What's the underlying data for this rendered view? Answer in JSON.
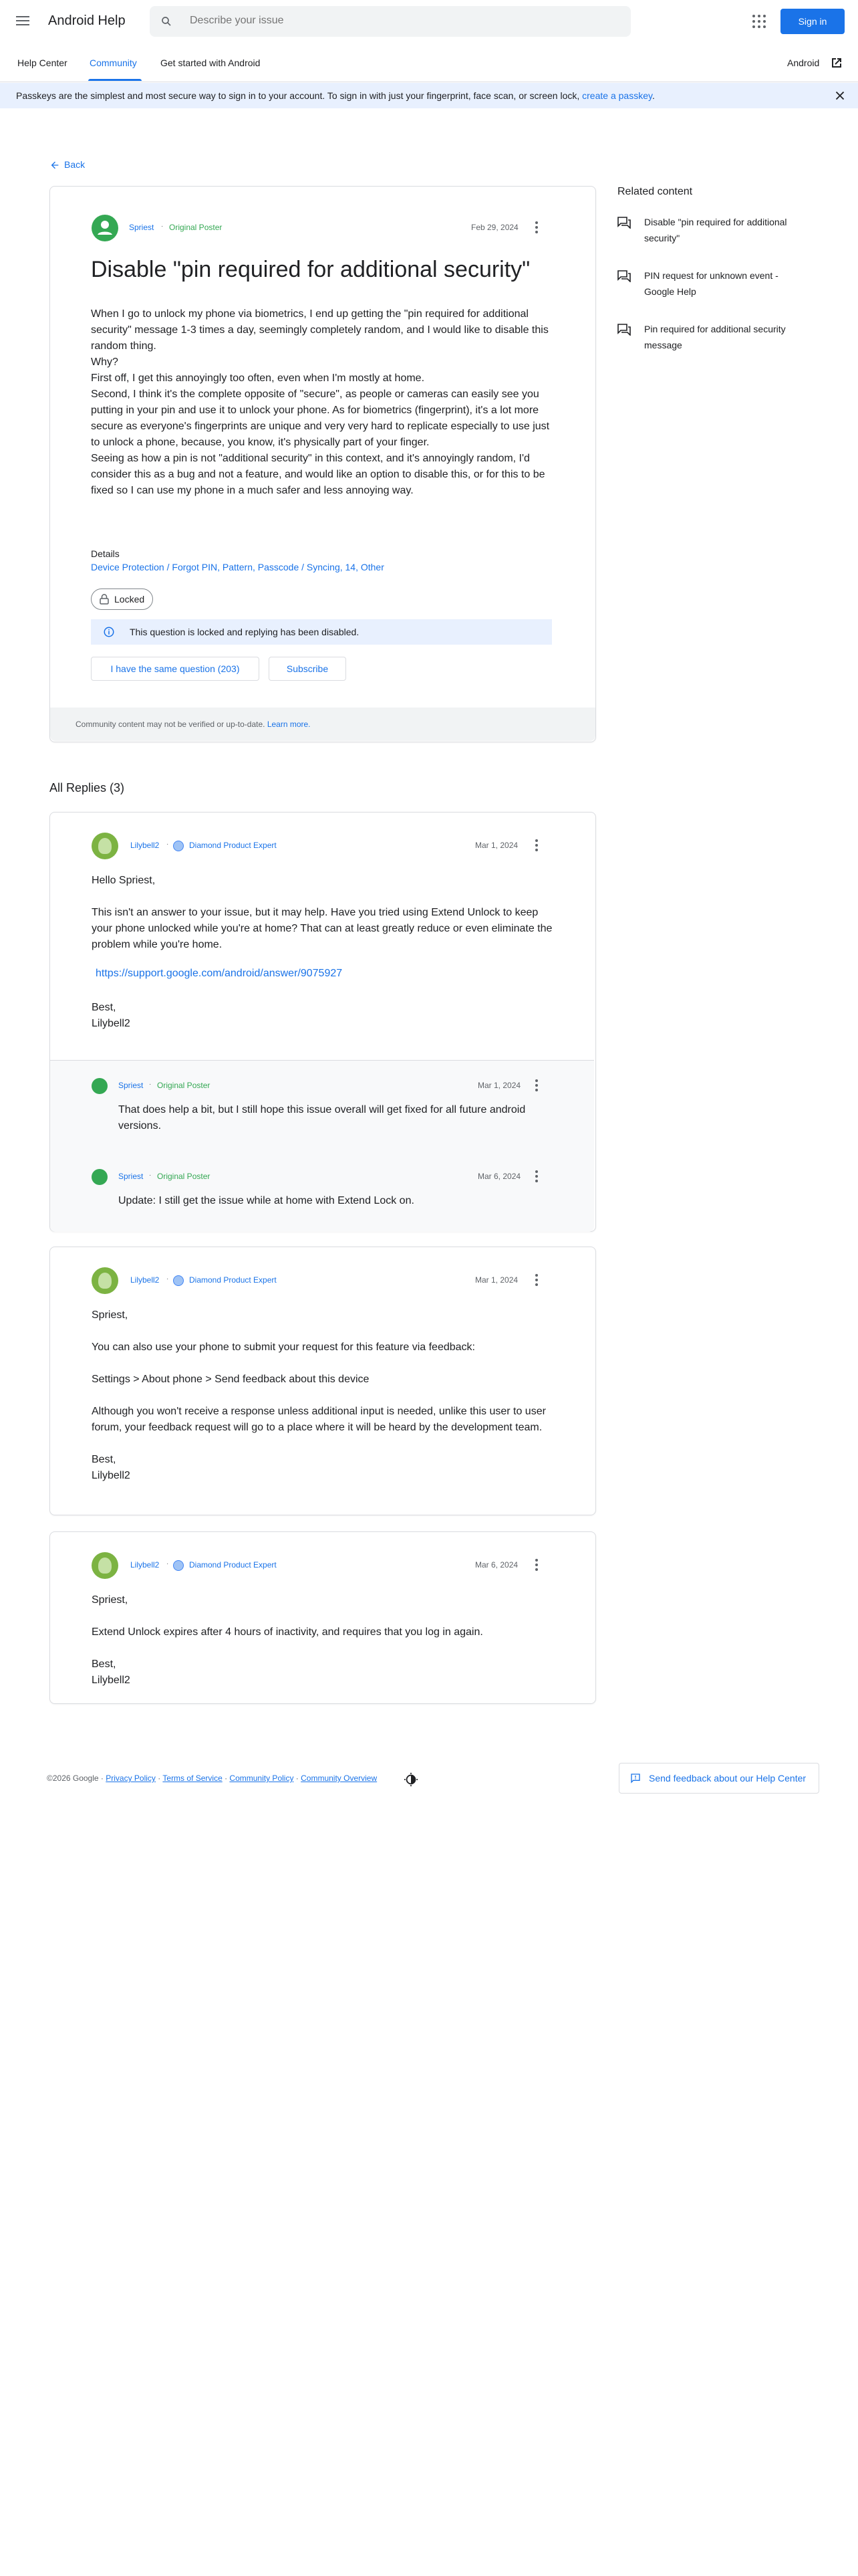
{
  "header": {
    "brand": "Android Help",
    "search_placeholder": "Describe your issue",
    "signin_label": "Sign in"
  },
  "tabs": [
    "Help Center",
    "Community",
    "Get started with Android"
  ],
  "android_link": "Android",
  "banner": {
    "text": "Passkeys are the simplest and most secure way to sign in to your account. To sign in with just your fingerprint, face scan, or screen lock, ",
    "link": "create a passkey",
    "suffix": "."
  },
  "back_label": "Back",
  "question": {
    "author": "Spriest",
    "author_badge": "Original Poster",
    "date": "Feb 29, 2024",
    "title": "Disable \"pin required for additional security\"",
    "body": "When I go to unlock my phone via biometrics, I end up getting the \"pin required for additional security\" message 1-3 times a day, seemingly completely random, and I would like to disable this random thing.\nWhy?\nFirst off, I get this annoyingly too often, even when I'm mostly at home.\nSecond, I think it's the complete opposite of \"secure\", as people or cameras can easily see you putting in your pin and use it to unlock your phone.  As for biometrics (fingerprint), it's a lot more secure as everyone's fingerprints are unique and very very hard to replicate especially to use just to unlock a phone, because, you know, it's physically part of your finger.\nSeeing as how a pin is not \"additional security\" in this context, and it's annoyingly random, I'd consider this as a bug and not a feature, and would like an option to disable this, or for this to be fixed so I can use my phone in a much safer and less annoying way.",
    "details_label": "Details",
    "details_value": "Device Protection / Forgot PIN, Pattern, Passcode / Syncing, 14, Other",
    "locked_label": "Locked",
    "locked_notice": "This question is locked and replying has been disabled.",
    "same_question_label": "I have the same question (203)",
    "subscribe_label": "Subscribe",
    "footer_text": "Community content may not be verified or up-to-date. ",
    "footer_link": "Learn more."
  },
  "related": {
    "heading": "Related content",
    "items": [
      "Disable \"pin required for additional security\"",
      "PIN request for unknown event - Google Help",
      "Pin required for additional security message"
    ]
  },
  "replies_heading": "All Replies (3)",
  "replies": [
    {
      "author": "Lilybell2",
      "badge": "Diamond Product Expert",
      "date": "Mar 1, 2024",
      "body": "Hello Spriest,\n\nThis isn't an answer to your issue, but it may help.  Have you tried using Extend Unlock to keep your phone unlocked while you're at home?  That can at least greatly reduce or even eliminate the problem while you're home.",
      "link": "https://support.google.com/android/answer/9075927",
      "sign": "Best,\nLilybell2",
      "subs": [
        {
          "author": "Spriest",
          "badge": "Original Poster",
          "date": "Mar 1, 2024",
          "body": "That does help a bit, but I still hope this issue overall will get fixed for all future android versions."
        },
        {
          "author": "Spriest",
          "badge": "Original Poster",
          "date": "Mar 6, 2024",
          "body": "Update:  I still get the issue while at home with Extend Lock on."
        }
      ]
    },
    {
      "author": "Lilybell2",
      "badge": "Diamond Product Expert",
      "date": "Mar 1, 2024",
      "body": "Spriest,\n\nYou can also use your phone to submit your request for this feature via feedback:\n\nSettings > About phone > Send feedback about this device\n\nAlthough you won't receive a response unless additional input is needed, unlike this user to user forum, your feedback request will go to a place where it will be heard by the development team.\n\nBest,\nLilybell2"
    },
    {
      "author": "Lilybell2",
      "badge": "Diamond Product Expert",
      "date": "Mar 6, 2024",
      "body": "Spriest,\n\nExtend Unlock expires after 4 hours of inactivity, and requires that you log in again.\n\nBest,\nLilybell2"
    }
  ],
  "footer": {
    "copyright": "©2026 Google",
    "links": [
      "Privacy Policy",
      "Terms of Service",
      "Community Policy",
      "Community Overview"
    ],
    "feedback_label": "Send feedback about our Help Center"
  }
}
